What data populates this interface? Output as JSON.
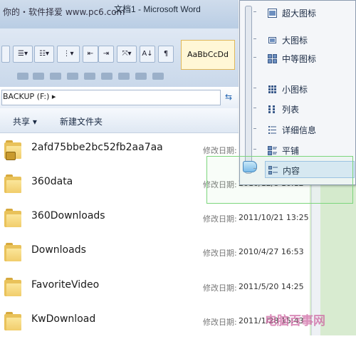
{
  "window": {
    "watermark_top": "你的・软件择爱 www.pc6.com",
    "title": "文档1 - Microsoft Word"
  },
  "ribbon": {
    "style_sample": "AaBbCcDd"
  },
  "address": {
    "path": "BACKUP (F:)  ▸"
  },
  "commandbar": {
    "share": "共享 ▾",
    "new_folder": "新建文件夹"
  },
  "files": [
    {
      "name": "2afd75bbe2bc52fb2aa7aa",
      "modified_label": "修改日期:",
      "modified": "",
      "locked": true
    },
    {
      "name": "360data",
      "modified_label": "修改日期:",
      "modified": "2010/12/8 10:12",
      "locked": false
    },
    {
      "name": "360Downloads",
      "modified_label": "修改日期:",
      "modified": "2011/10/21 13:25",
      "locked": false
    },
    {
      "name": "Downloads",
      "modified_label": "修改日期:",
      "modified": "2010/4/27 16:53",
      "locked": false
    },
    {
      "name": "FavoriteVideo",
      "modified_label": "修改日期:",
      "modified": "2011/5/20 14:25",
      "locked": false
    },
    {
      "name": "KwDownload",
      "modified_label": "修改日期:",
      "modified": "2011/1/28 15:43",
      "locked": false
    }
  ],
  "view_menu": {
    "items": [
      {
        "label": "超大图标",
        "icon": "extra-large-icons-icon"
      },
      {
        "label": "大图标",
        "icon": "large-icons-icon"
      },
      {
        "label": "中等图标",
        "icon": "medium-icons-icon"
      },
      {
        "label": "小图标",
        "icon": "small-icons-icon"
      },
      {
        "label": "列表",
        "icon": "list-view-icon"
      },
      {
        "label": "详细信息",
        "icon": "details-view-icon"
      },
      {
        "label": "平铺",
        "icon": "tiles-view-icon"
      },
      {
        "label": "内容",
        "icon": "content-view-icon",
        "selected": true
      }
    ]
  },
  "watermark_bottom": "电脑百事网",
  "colors": {
    "menu_selected_bg": "#dbe9f8",
    "folder_yellow": "#f1cd6b",
    "highlight_green": "#7cd67c"
  }
}
